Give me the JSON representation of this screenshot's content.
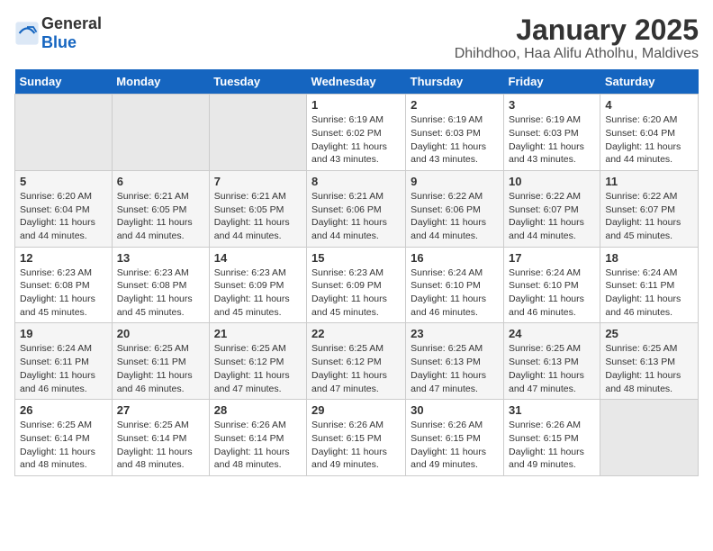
{
  "header": {
    "logo_general": "General",
    "logo_blue": "Blue",
    "title": "January 2025",
    "subtitle": "Dhihdhoo, Haa Alifu Atholhu, Maldives"
  },
  "weekdays": [
    "Sunday",
    "Monday",
    "Tuesday",
    "Wednesday",
    "Thursday",
    "Friday",
    "Saturday"
  ],
  "weeks": [
    [
      {
        "day": "",
        "detail": ""
      },
      {
        "day": "",
        "detail": ""
      },
      {
        "day": "",
        "detail": ""
      },
      {
        "day": "1",
        "detail": "Sunrise: 6:19 AM\nSunset: 6:02 PM\nDaylight: 11 hours\nand 43 minutes."
      },
      {
        "day": "2",
        "detail": "Sunrise: 6:19 AM\nSunset: 6:03 PM\nDaylight: 11 hours\nand 43 minutes."
      },
      {
        "day": "3",
        "detail": "Sunrise: 6:19 AM\nSunset: 6:03 PM\nDaylight: 11 hours\nand 43 minutes."
      },
      {
        "day": "4",
        "detail": "Sunrise: 6:20 AM\nSunset: 6:04 PM\nDaylight: 11 hours\nand 44 minutes."
      }
    ],
    [
      {
        "day": "5",
        "detail": "Sunrise: 6:20 AM\nSunset: 6:04 PM\nDaylight: 11 hours\nand 44 minutes."
      },
      {
        "day": "6",
        "detail": "Sunrise: 6:21 AM\nSunset: 6:05 PM\nDaylight: 11 hours\nand 44 minutes."
      },
      {
        "day": "7",
        "detail": "Sunrise: 6:21 AM\nSunset: 6:05 PM\nDaylight: 11 hours\nand 44 minutes."
      },
      {
        "day": "8",
        "detail": "Sunrise: 6:21 AM\nSunset: 6:06 PM\nDaylight: 11 hours\nand 44 minutes."
      },
      {
        "day": "9",
        "detail": "Sunrise: 6:22 AM\nSunset: 6:06 PM\nDaylight: 11 hours\nand 44 minutes."
      },
      {
        "day": "10",
        "detail": "Sunrise: 6:22 AM\nSunset: 6:07 PM\nDaylight: 11 hours\nand 44 minutes."
      },
      {
        "day": "11",
        "detail": "Sunrise: 6:22 AM\nSunset: 6:07 PM\nDaylight: 11 hours\nand 45 minutes."
      }
    ],
    [
      {
        "day": "12",
        "detail": "Sunrise: 6:23 AM\nSunset: 6:08 PM\nDaylight: 11 hours\nand 45 minutes."
      },
      {
        "day": "13",
        "detail": "Sunrise: 6:23 AM\nSunset: 6:08 PM\nDaylight: 11 hours\nand 45 minutes."
      },
      {
        "day": "14",
        "detail": "Sunrise: 6:23 AM\nSunset: 6:09 PM\nDaylight: 11 hours\nand 45 minutes."
      },
      {
        "day": "15",
        "detail": "Sunrise: 6:23 AM\nSunset: 6:09 PM\nDaylight: 11 hours\nand 45 minutes."
      },
      {
        "day": "16",
        "detail": "Sunrise: 6:24 AM\nSunset: 6:10 PM\nDaylight: 11 hours\nand 46 minutes."
      },
      {
        "day": "17",
        "detail": "Sunrise: 6:24 AM\nSunset: 6:10 PM\nDaylight: 11 hours\nand 46 minutes."
      },
      {
        "day": "18",
        "detail": "Sunrise: 6:24 AM\nSunset: 6:11 PM\nDaylight: 11 hours\nand 46 minutes."
      }
    ],
    [
      {
        "day": "19",
        "detail": "Sunrise: 6:24 AM\nSunset: 6:11 PM\nDaylight: 11 hours\nand 46 minutes."
      },
      {
        "day": "20",
        "detail": "Sunrise: 6:25 AM\nSunset: 6:11 PM\nDaylight: 11 hours\nand 46 minutes."
      },
      {
        "day": "21",
        "detail": "Sunrise: 6:25 AM\nSunset: 6:12 PM\nDaylight: 11 hours\nand 47 minutes."
      },
      {
        "day": "22",
        "detail": "Sunrise: 6:25 AM\nSunset: 6:12 PM\nDaylight: 11 hours\nand 47 minutes."
      },
      {
        "day": "23",
        "detail": "Sunrise: 6:25 AM\nSunset: 6:13 PM\nDaylight: 11 hours\nand 47 minutes."
      },
      {
        "day": "24",
        "detail": "Sunrise: 6:25 AM\nSunset: 6:13 PM\nDaylight: 11 hours\nand 47 minutes."
      },
      {
        "day": "25",
        "detail": "Sunrise: 6:25 AM\nSunset: 6:13 PM\nDaylight: 11 hours\nand 48 minutes."
      }
    ],
    [
      {
        "day": "26",
        "detail": "Sunrise: 6:25 AM\nSunset: 6:14 PM\nDaylight: 11 hours\nand 48 minutes."
      },
      {
        "day": "27",
        "detail": "Sunrise: 6:25 AM\nSunset: 6:14 PM\nDaylight: 11 hours\nand 48 minutes."
      },
      {
        "day": "28",
        "detail": "Sunrise: 6:26 AM\nSunset: 6:14 PM\nDaylight: 11 hours\nand 48 minutes."
      },
      {
        "day": "29",
        "detail": "Sunrise: 6:26 AM\nSunset: 6:15 PM\nDaylight: 11 hours\nand 49 minutes."
      },
      {
        "day": "30",
        "detail": "Sunrise: 6:26 AM\nSunset: 6:15 PM\nDaylight: 11 hours\nand 49 minutes."
      },
      {
        "day": "31",
        "detail": "Sunrise: 6:26 AM\nSunset: 6:15 PM\nDaylight: 11 hours\nand 49 minutes."
      },
      {
        "day": "",
        "detail": ""
      }
    ]
  ]
}
